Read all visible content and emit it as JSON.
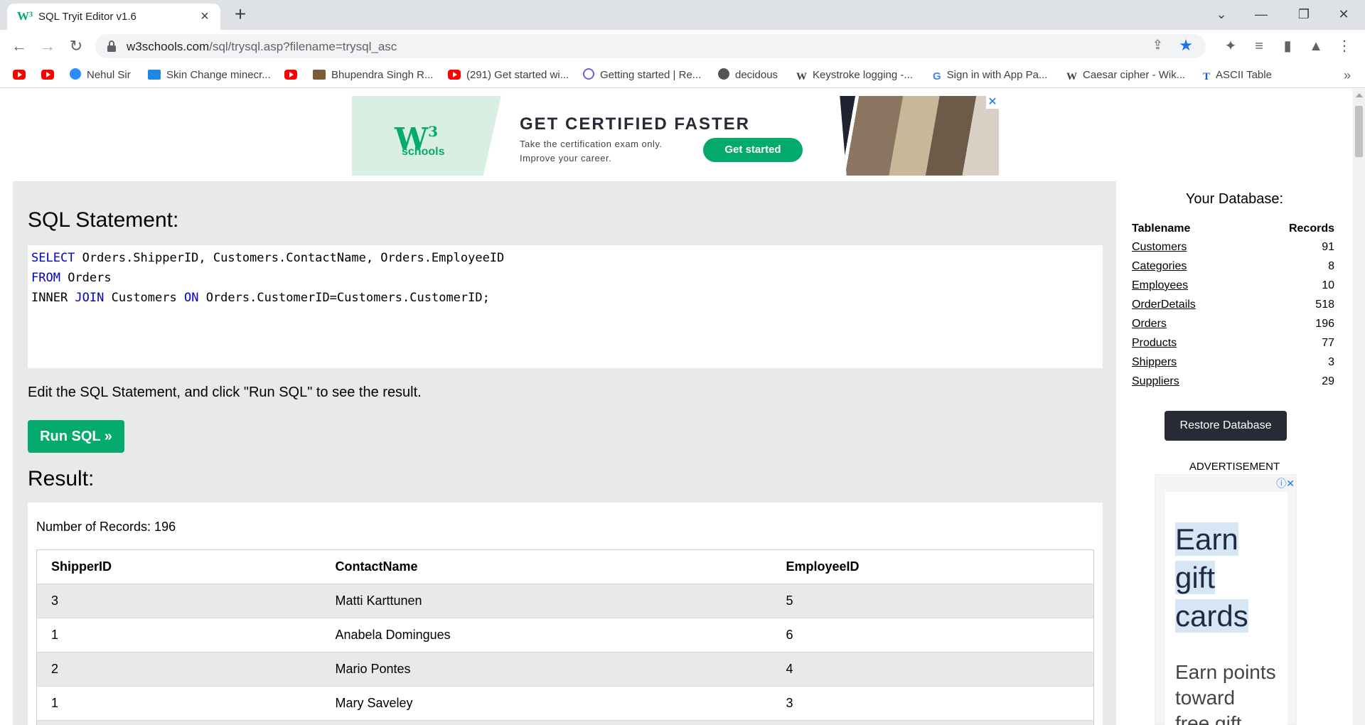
{
  "browser": {
    "tab_title": "SQL Tryit Editor v1.6",
    "url_domain": "w3schools.com",
    "url_path": "/sql/trysql.asp?filename=trysql_asc",
    "bookmarks": [
      "Nehul Sir",
      "Skin Change minecr...",
      "Bhupendra Singh R...",
      "(291) Get started wi...",
      "Getting started | Re...",
      "decidous",
      "Keystroke logging -...",
      "Sign in with App Pa...",
      "Caesar cipher - Wik...",
      "ASCII Table"
    ]
  },
  "ad_banner": {
    "logo_sup": "3",
    "logo_sub": "schools",
    "headline": "GET CERTIFIED FASTER",
    "sub_line1": "Take the certification exam only.",
    "sub_line2": "Improve your career.",
    "cta": "Get started"
  },
  "editor": {
    "heading": "SQL Statement:",
    "code": {
      "l1_kw": "SELECT",
      "l1_rest": " Orders.ShipperID, Customers.ContactName, Orders.EmployeeID",
      "l2_kw": "FROM",
      "l2_rest": " Orders",
      "l3_a": "INNER ",
      "l3_kw1": "JOIN",
      "l3_b": " Customers ",
      "l3_kw2": "ON",
      "l3_c": " Orders.CustomerID=Customers.CustomerID;"
    },
    "instructions": "Edit the SQL Statement, and click \"Run SQL\" to see the result.",
    "run_button": "Run SQL »"
  },
  "result": {
    "heading": "Result:",
    "count_text": "Number of Records: 196",
    "columns": [
      "ShipperID",
      "ContactName",
      "EmployeeID"
    ],
    "rows": [
      [
        "3",
        "Matti Karttunen",
        "5"
      ],
      [
        "1",
        "Anabela Domingues",
        "6"
      ],
      [
        "2",
        "Mario Pontes",
        "4"
      ],
      [
        "1",
        "Mary Saveley",
        "3"
      ]
    ]
  },
  "sidebar": {
    "title": "Your Database:",
    "col_name": "Tablename",
    "col_records": "Records",
    "tables": [
      {
        "name": "Customers",
        "records": "91"
      },
      {
        "name": "Categories",
        "records": "8"
      },
      {
        "name": "Employees",
        "records": "10"
      },
      {
        "name": "OrderDetails",
        "records": "518"
      },
      {
        "name": "Orders",
        "records": "196"
      },
      {
        "name": "Products",
        "records": "77"
      },
      {
        "name": "Shippers",
        "records": "3"
      },
      {
        "name": "Suppliers",
        "records": "29"
      }
    ],
    "restore_button": "Restore Database",
    "ad_label": "ADVERTISEMENT",
    "ad_big": [
      "Earn",
      "gift",
      "cards"
    ],
    "ad_small": [
      "Earn points",
      "toward",
      "free gift"
    ]
  },
  "colors": {
    "accent_green": "#04aa6d",
    "dark_button": "#282a35",
    "panel_gray": "#e7e9eb",
    "keyword_blue": "#0000cd"
  }
}
